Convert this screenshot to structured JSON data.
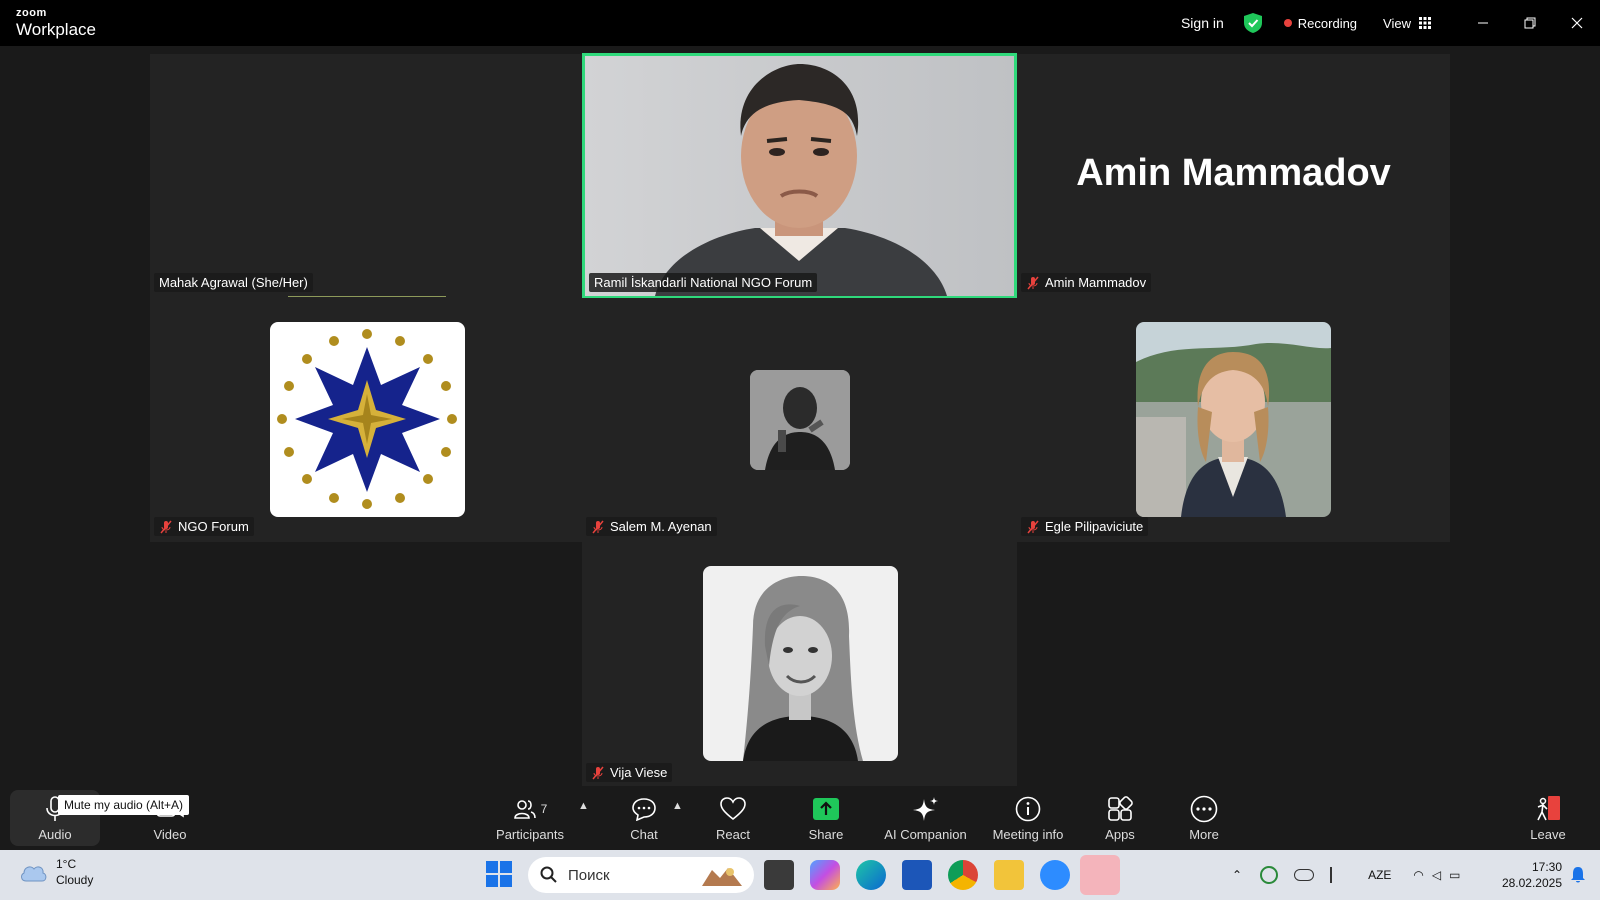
{
  "titlebar": {
    "logo_top": "zoom",
    "logo_bottom": "Workplace",
    "sign_in": "Sign in",
    "recording": "Recording",
    "view": "View",
    "colors": {
      "shield": "#1fc75a",
      "recording_dot": "#e8423d"
    }
  },
  "participants": [
    {
      "name": "Mahak Agrawal (She/Her)",
      "muted": false
    },
    {
      "name": "Ramil İskandarli National NGO Forum",
      "muted": false,
      "active_speaker": true
    },
    {
      "name": "Amin Mammadov",
      "muted": true,
      "display_text": "Amin Mammadov"
    },
    {
      "name": "NGO Forum",
      "muted": true
    },
    {
      "name": "Salem M. Ayenan",
      "muted": true
    },
    {
      "name": "Egle Pilipaviciute",
      "muted": true
    },
    {
      "name": "Vija Viese",
      "muted": true
    }
  ],
  "toolbar": {
    "tooltip": "Mute my audio (Alt+A)",
    "audio": "Audio",
    "video": "Video",
    "participants": "Participants",
    "participants_count": "7",
    "chat": "Chat",
    "react": "React",
    "share": "Share",
    "ai_companion": "AI Companion",
    "meeting_info": "Meeting info",
    "apps": "Apps",
    "more": "More",
    "leave": "Leave"
  },
  "taskbar": {
    "temperature": "1°C",
    "condition": "Cloudy",
    "search_placeholder": "Поиск",
    "language": "AZE",
    "time": "17:30",
    "date": "28.02.2025"
  }
}
